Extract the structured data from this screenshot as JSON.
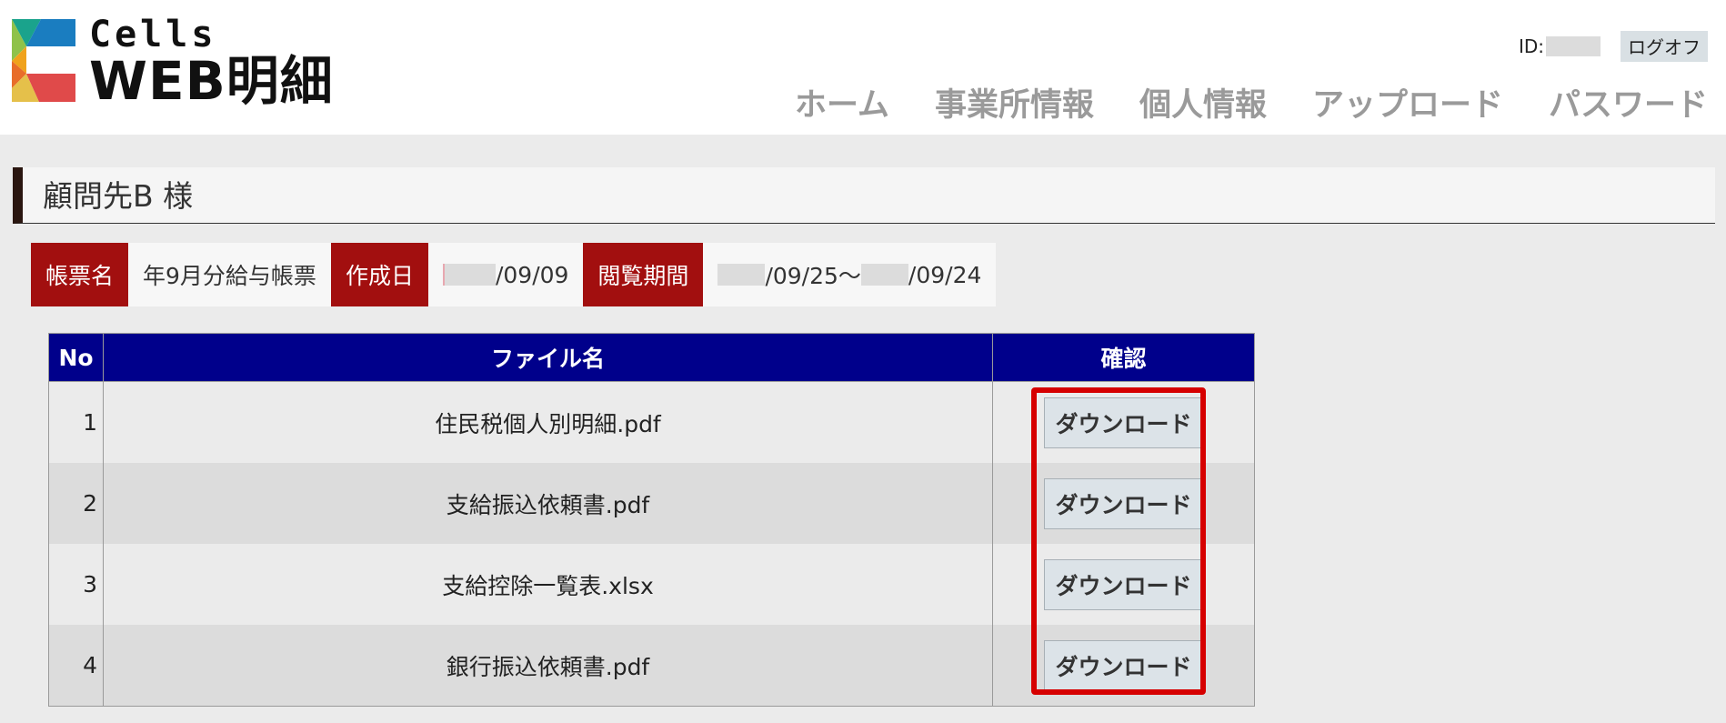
{
  "app": {
    "logo_top": "Cells",
    "logo_bottom": "WEB明細"
  },
  "user": {
    "id_label": "ID:",
    "logoff_label": "ログオフ"
  },
  "nav": {
    "items": [
      "ホーム",
      "事業所情報",
      "個人情報",
      "アップロード",
      "パスワード"
    ]
  },
  "client": {
    "title": "顧問先B 様"
  },
  "meta": {
    "form_name_label": "帳票名",
    "form_name_value": "年9月分給与帳票",
    "created_label": "作成日",
    "created_value": "/09/09",
    "period_label": "閲覧期間",
    "period_start": "/09/25〜",
    "period_end": "/09/24"
  },
  "table": {
    "headers": {
      "no": "No",
      "file": "ファイル名",
      "check": "確認"
    },
    "rows": [
      {
        "no": "1",
        "file": "住民税個人別明細.pdf",
        "action": "ダウンロード"
      },
      {
        "no": "2",
        "file": "支給振込依頼書.pdf",
        "action": "ダウンロード"
      },
      {
        "no": "3",
        "file": "支給控除一覧表.xlsx",
        "action": "ダウンロード"
      },
      {
        "no": "4",
        "file": "銀行振込依頼書.pdf",
        "action": "ダウンロード"
      }
    ]
  },
  "colors": {
    "header_bg": "#00008b",
    "meta_label_bg": "#a20f0f",
    "highlight": "#d60000",
    "nav_text": "#9a9a9a"
  }
}
